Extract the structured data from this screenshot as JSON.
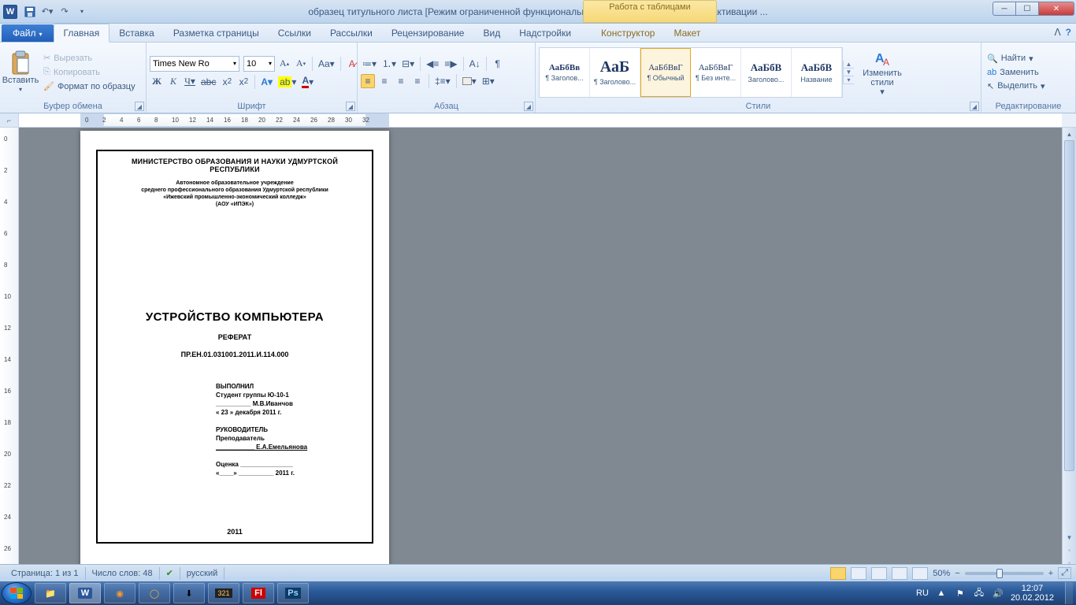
{
  "titlebar": {
    "title": "образец титульного листа [Режим ограниченной функциональности]  -  Microsoft Word  (Сбой активации ...",
    "tabletools": "Работа с таблицами"
  },
  "tabs": {
    "file": "Файл",
    "items": [
      "Главная",
      "Вставка",
      "Разметка страницы",
      "Ссылки",
      "Рассылки",
      "Рецензирование",
      "Вид",
      "Надстройки"
    ],
    "tabletabs": [
      "Конструктор",
      "Макет"
    ]
  },
  "ribbon": {
    "clipboard": {
      "label": "Буфер обмена",
      "paste": "Вставить",
      "cut": "Вырезать",
      "copy": "Копировать",
      "format": "Формат по образцу"
    },
    "font": {
      "label": "Шрифт",
      "name": "Times New Ro",
      "size": "10"
    },
    "paragraph": {
      "label": "Абзац"
    },
    "styles": {
      "label": "Стили",
      "items": [
        {
          "sample": "АаБбВв",
          "name": "¶ Заголов...",
          "bold": true,
          "size": "11px"
        },
        {
          "sample": "АаБ",
          "name": "¶ Заголово...",
          "bold": true,
          "size": "20px"
        },
        {
          "sample": "АаБбВвГ",
          "name": "¶ Обычный",
          "bold": false,
          "size": "11px",
          "selected": true
        },
        {
          "sample": "АаБбВвГ",
          "name": "¶ Без инте...",
          "bold": false,
          "size": "11px"
        },
        {
          "sample": "АаБбВ",
          "name": "Заголово...",
          "bold": true,
          "size": "13px"
        },
        {
          "sample": "АаБбВ",
          "name": "Название",
          "bold": true,
          "size": "13px"
        }
      ],
      "change": "Изменить стили"
    },
    "editing": {
      "label": "Редактирование",
      "find": "Найти",
      "replace": "Заменить",
      "select": "Выделить"
    }
  },
  "document": {
    "hdr1": "МИНИСТЕРСТВО ОБРАЗОВАНИЯ И НАУКИ УДМУРТСКОЙ РЕСПУБЛИКИ",
    "hdr2a": "Автономное образовательное учреждение",
    "hdr2b": "среднего профессионального образования Удмуртской республики",
    "hdr2c": "«Ижевский промышленно-экономический   колледж»",
    "hdr2d": "(АОУ «ИПЭК»)",
    "title": "УСТРОЙСТВО  КОМПЬЮТЕРА",
    "sub": "РЕФЕРАТ",
    "code": "ПР.ЕН.01.031001.2011.И.114.000",
    "sb1": "ВЫПОЛНИЛ",
    "sb2": "Студент группы Ю-10-1",
    "sb3": "__________ М.В.Иванчов",
    "sb4": "« 23 »   декабря 2011 г.",
    "sb5": "РУКОВОДИТЕЛЬ",
    "sb6": "Преподаватель",
    "sb7": "___________ Е.А.Емельянова",
    "sb8": "Оценка _______________",
    "sb9": "«____»  __________ 2011 г.",
    "year": "2011"
  },
  "status": {
    "page": "Страница: 1 из 1",
    "words": "Число слов: 48",
    "lang": "русский",
    "zoom": "50%"
  },
  "tray": {
    "lang": "RU",
    "time": "12:07",
    "date": "20.02.2012"
  }
}
